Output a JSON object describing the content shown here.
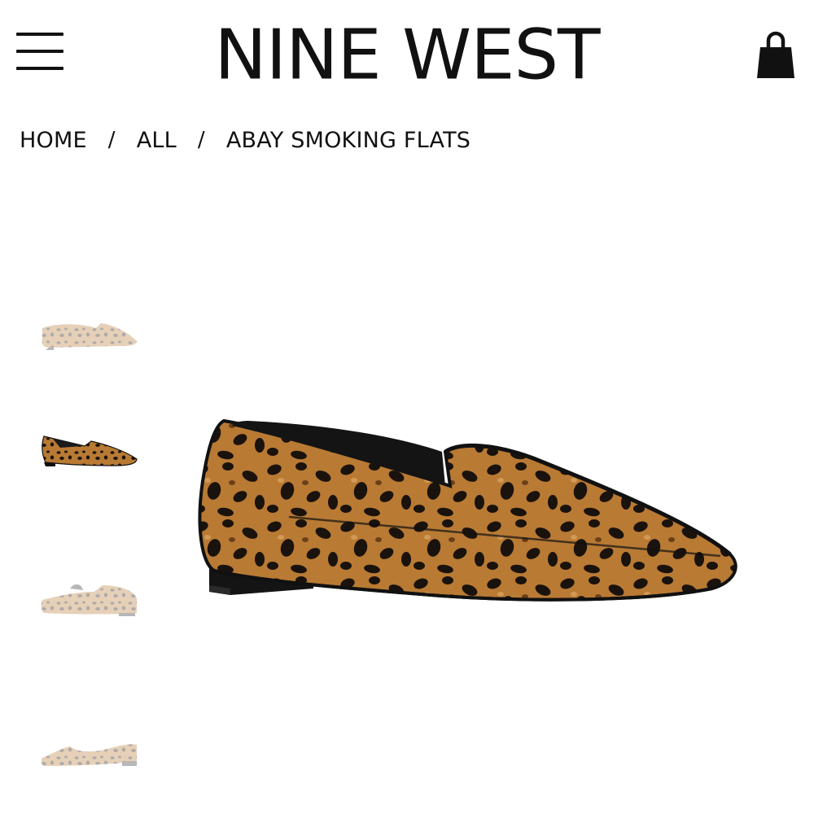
{
  "header": {
    "brand": "NINE WEST",
    "menu_icon": "hamburger-menu-icon",
    "bag_icon": "shopping-bag-icon"
  },
  "breadcrumb": {
    "items": [
      "HOME",
      "ALL",
      "ABAY SMOKING FLATS"
    ],
    "separator": "/"
  },
  "product": {
    "gallery": {
      "thumbnails": [
        {
          "view": "side",
          "selected": false
        },
        {
          "view": "angle",
          "selected": true
        },
        {
          "view": "back-angle",
          "selected": false
        },
        {
          "view": "inner-side",
          "selected": false
        }
      ]
    }
  },
  "colors": {
    "text": "#111111",
    "background": "#ffffff",
    "leopard_base": "#b5762f",
    "leopard_spot": "#1a120c"
  }
}
